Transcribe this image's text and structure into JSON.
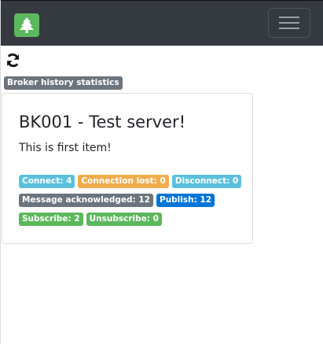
{
  "navbar": {
    "brand_icon": "tree-icon",
    "brand_color": "#5cb85c",
    "toggler_icon": "hamburger-menu-icon"
  },
  "toolbar": {
    "refresh_icon": "refresh-icon"
  },
  "section_label": "Broker history statistics",
  "card": {
    "title": "BK001 - Test server!",
    "text": "This is first item!",
    "badges": [
      [
        {
          "label": "Connect: 4",
          "color": "#5bc0de"
        },
        {
          "label": "Connection lost: 0",
          "color": "#f0ad4e"
        },
        {
          "label": "Disconnect: 0",
          "color": "#5bc0de"
        }
      ],
      [
        {
          "label": "Message acknowledged: 12",
          "color": "#6c757d"
        },
        {
          "label": "Publish: 12",
          "color": "#0275d8"
        }
      ],
      [
        {
          "label": "Subscribe: 2",
          "color": "#5cb85c"
        },
        {
          "label": "Unsubscribe: 0",
          "color": "#5cb85c"
        }
      ]
    ]
  }
}
